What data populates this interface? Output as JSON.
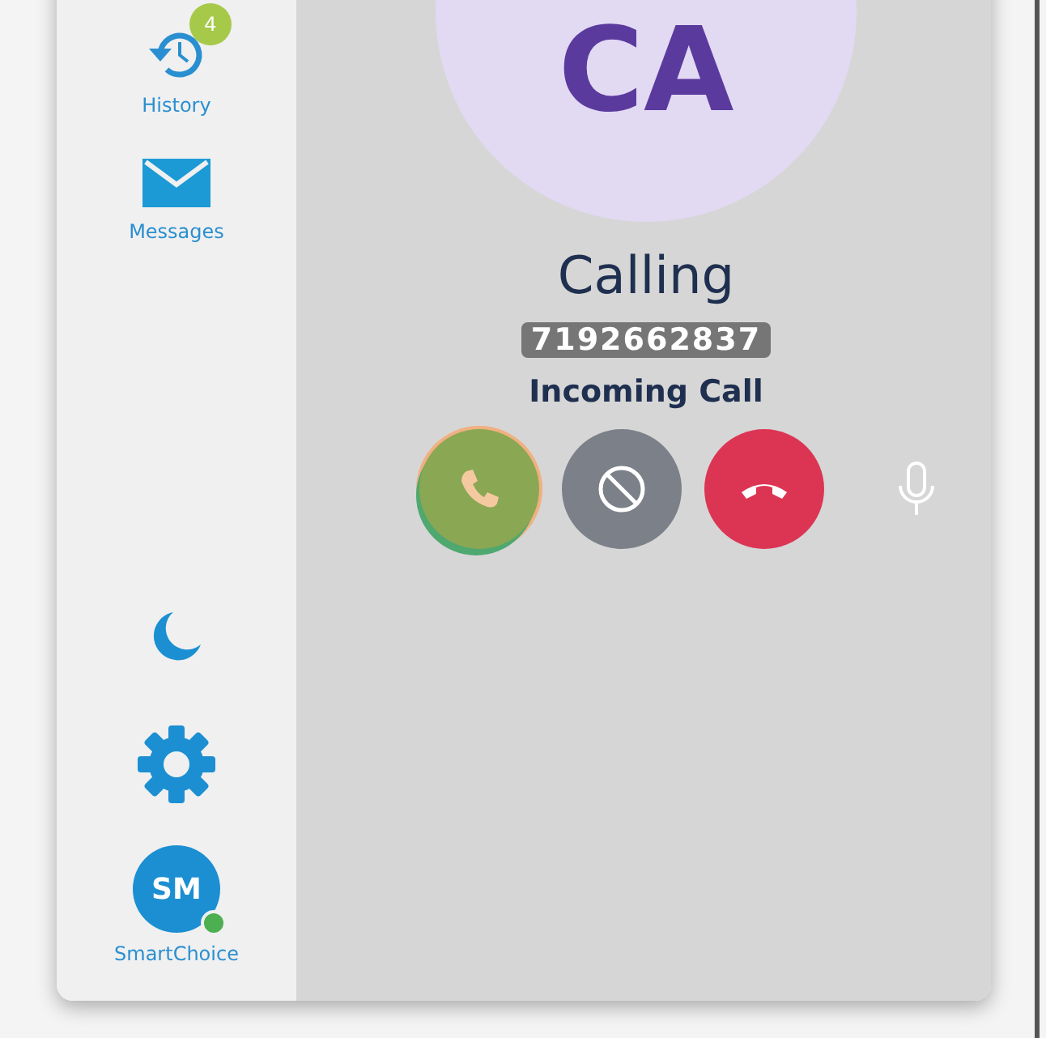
{
  "sidebar": {
    "items": [
      {
        "kind": "history",
        "label": "History",
        "badge": "4"
      },
      {
        "kind": "messages",
        "label": "Messages"
      }
    ],
    "bottom": [
      {
        "kind": "moon"
      },
      {
        "kind": "settings"
      }
    ],
    "profile": {
      "initials": "SM",
      "name": "SmartChoice",
      "online": true
    }
  },
  "call": {
    "initials": "CA",
    "title": "Calling",
    "number": "7192662837",
    "status": "Incoming Call",
    "actions": [
      {
        "kind": "answer"
      },
      {
        "kind": "ignore"
      },
      {
        "kind": "hangup"
      },
      {
        "kind": "mute"
      }
    ]
  }
}
